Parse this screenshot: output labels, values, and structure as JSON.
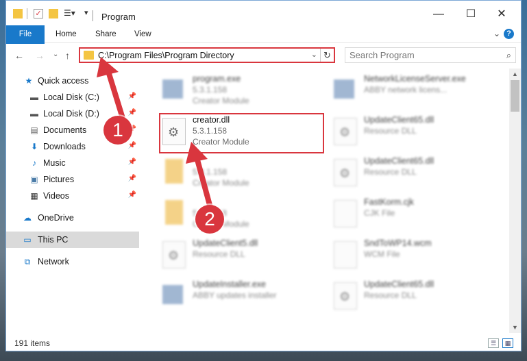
{
  "window": {
    "title": "Program",
    "minimize": "—",
    "maximize": "☐",
    "close": "✕"
  },
  "ribbon": {
    "tabs": [
      "File",
      "Home",
      "Share",
      "View"
    ],
    "help": "?"
  },
  "address": {
    "path": "C:\\Program Files\\Program Directory",
    "search_placeholder": "Search Program"
  },
  "sidebar": {
    "items": [
      {
        "label": "Quick access",
        "icon": "star-icon",
        "pinned": false
      },
      {
        "label": "Local Disk (C:)",
        "icon": "drive-icon",
        "pinned": true
      },
      {
        "label": "Local Disk (D:)",
        "icon": "drive-icon",
        "pinned": true
      },
      {
        "label": "Documents",
        "icon": "documents-icon",
        "pinned": true
      },
      {
        "label": "Downloads",
        "icon": "download-icon",
        "pinned": true
      },
      {
        "label": "Music",
        "icon": "music-icon",
        "pinned": true
      },
      {
        "label": "Pictures",
        "icon": "pictures-icon",
        "pinned": true
      },
      {
        "label": "Videos",
        "icon": "videos-icon",
        "pinned": true
      },
      {
        "label": "OneDrive",
        "icon": "cloud-icon",
        "pinned": false
      },
      {
        "label": "This PC",
        "icon": "computer-icon",
        "pinned": false,
        "selected": true
      },
      {
        "label": "Network",
        "icon": "network-icon",
        "pinned": false
      }
    ]
  },
  "files": [
    {
      "name": "program.exe",
      "version": "5.3.1.158",
      "description": "Creator Module"
    },
    {
      "name": "NetworkLicenseServer.exe",
      "version": "ABBY network licens...",
      "description": ""
    },
    {
      "name": "creator.dll",
      "version": "5.3.1.158",
      "description": "Creator Module"
    },
    {
      "name": "UpdateClient65.dll",
      "version": "Resource DLL",
      "description": ""
    },
    {
      "name": "",
      "version": "5.3.1.158",
      "description": "Creator Module"
    },
    {
      "name": "UpdateClient65.dll",
      "version": "Resource DLL",
      "description": ""
    },
    {
      "name": "",
      "version": "5.3.1.158",
      "description": "Creator Module"
    },
    {
      "name": "FastKorm.cjk",
      "version": "CJK File",
      "description": ""
    },
    {
      "name": "UpdateClient5.dll",
      "version": "Resource DLL",
      "description": ""
    },
    {
      "name": "SndToWP14.wcm",
      "version": "WCM File",
      "description": ""
    },
    {
      "name": "UpdateInstaller.exe",
      "version": "ABBY updates installer",
      "description": ""
    },
    {
      "name": "UpdateClient65.dll",
      "version": "Resource DLL",
      "description": ""
    }
  ],
  "status": {
    "item_count": "191 items"
  },
  "annotations": {
    "step1": "1",
    "step2": "2"
  },
  "colors": {
    "accent": "#1979ca",
    "highlight": "#d9363e",
    "folder": "#f4c542"
  }
}
